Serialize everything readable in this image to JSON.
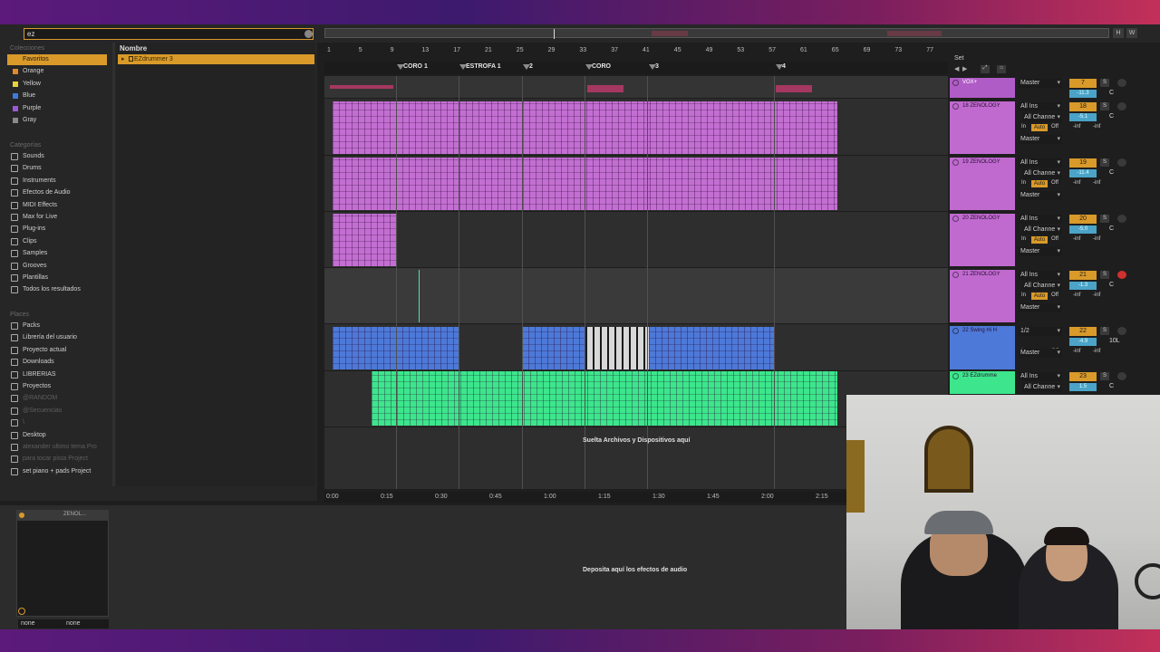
{
  "browser": {
    "search_value": "ez",
    "collections_label": "Colecciones",
    "collections": [
      {
        "label": "Favoritos",
        "color": "#d99a2a",
        "active": true
      },
      {
        "label": "Orange",
        "color": "#e08a2a",
        "active": false
      },
      {
        "label": "Yellow",
        "color": "#e6d23a",
        "active": false
      },
      {
        "label": "Blue",
        "color": "#3b7be0",
        "active": false
      },
      {
        "label": "Purple",
        "color": "#9b59d6",
        "active": false
      },
      {
        "label": "Gray",
        "color": "#8a8a8a",
        "active": false
      }
    ],
    "categories_label": "Categorías",
    "categories": [
      "Sounds",
      "Drums",
      "Instruments",
      "Efectos de Audio",
      "MIDI Effects",
      "Max for Live",
      "Plug-ins",
      "Clips",
      "Samples",
      "Grooves",
      "Plantillas",
      "Todos los resultados"
    ],
    "places_label": "Places",
    "places": [
      {
        "label": "Packs",
        "dim": false
      },
      {
        "label": "Librería del usuario",
        "dim": false
      },
      {
        "label": "Proyecto actual",
        "dim": false
      },
      {
        "label": "Downloads",
        "dim": false
      },
      {
        "label": "LIBRERIAS",
        "dim": false
      },
      {
        "label": "Proyectos",
        "dim": false
      },
      {
        "label": "@RANDOM",
        "dim": true
      },
      {
        "label": "@Secuencias",
        "dim": true
      },
      {
        "label": "\\",
        "dim": true
      },
      {
        "label": "Desktop",
        "dim": false
      },
      {
        "label": "alexander ultimo tema Pro",
        "dim": true
      },
      {
        "label": "para tocar pista Project",
        "dim": true
      },
      {
        "label": "set piano + pads Project",
        "dim": false
      }
    ],
    "name_header": "Nombre",
    "result": "EZdrummer 3"
  },
  "ruler": {
    "bars": [
      "1",
      "5",
      "9",
      "13",
      "17",
      "21",
      "25",
      "29",
      "33",
      "37",
      "41",
      "45",
      "49",
      "53",
      "57",
      "61",
      "65",
      "69",
      "73",
      "77"
    ],
    "locators": [
      {
        "label": "CORO 1"
      },
      {
        "label": "ESTROFA 1"
      },
      {
        "label": "2"
      },
      {
        "label": "CORO"
      },
      {
        "label": "3"
      },
      {
        "label": "4"
      }
    ],
    "times": [
      "0:00",
      "0:15",
      "0:30",
      "0:45",
      "1:00",
      "1:15",
      "1:30",
      "1:45",
      "2:00",
      "2:15"
    ],
    "set_label": "Set"
  },
  "arrangement": {
    "drop_files_text": "Suelta Archivos y Dispositivos aquí",
    "drop_effects_text": "Deposita aquí los efectos de audio"
  },
  "tracks": [
    {
      "name": "VOX+",
      "input": "Master",
      "num": "7",
      "vol": "-11.3",
      "pan": "C",
      "color": "#b05cc6"
    },
    {
      "name": "18 ZENOLOGY",
      "input": "All Ins",
      "channel": "All Channe",
      "out": "Master",
      "num": "18",
      "vol": "-5.1",
      "pan": "C",
      "color": "#c06ad0"
    },
    {
      "name": "19 ZENOLOGY",
      "input": "All Ins",
      "channel": "All Channe",
      "out": "Master",
      "num": "19",
      "vol": "-11.4",
      "pan": "C",
      "color": "#c06ad0"
    },
    {
      "name": "20 ZENOLOGY",
      "input": "All Ins",
      "channel": "All Channe",
      "out": "Master",
      "num": "20",
      "vol": "-5.0",
      "pan": "C",
      "color": "#c06ad0"
    },
    {
      "name": "21 ZENOLOGY",
      "input": "All Ins",
      "channel": "All Channe",
      "out": "Master",
      "num": "21",
      "vol": "-1.3",
      "pan": "C",
      "color": "#c06ad0"
    },
    {
      "name": "22 Swing Hi H",
      "input": "1/2",
      "out": "Master",
      "num": "22",
      "vol": "-4.9",
      "pan": "10L",
      "color": "#4d79d8"
    },
    {
      "name": "23 EZdrumme",
      "input": "All Ins",
      "channel": "All Channe",
      "num": "23",
      "vol": "1.5",
      "pan": "C",
      "color": "#3de68c"
    }
  ],
  "mixer_labels": {
    "in": "In",
    "auto": "Auto",
    "off": "Off",
    "inf": "-inf",
    "s": "S"
  },
  "device": {
    "dropdown_1": "none",
    "dropdown_2": "none",
    "title": "ZENOL..."
  }
}
